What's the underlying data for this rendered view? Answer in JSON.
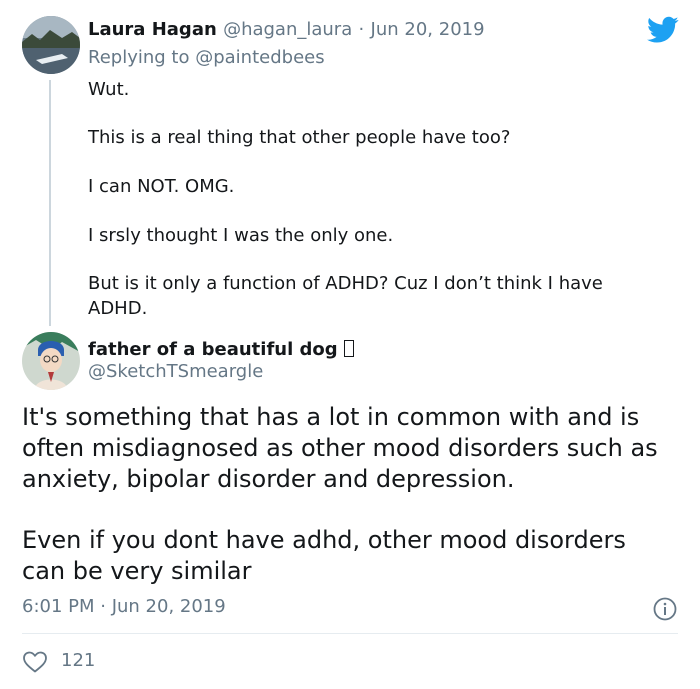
{
  "reply_tweet": {
    "display_name": "Laura Hagan",
    "handle": "@hagan_laura",
    "separator": "·",
    "date": "Jun 20, 2019",
    "replying_prefix": "Replying to",
    "replying_to": "@paintedbees",
    "paragraphs": [
      "Wut.",
      "This is a real thing that other people have too?",
      "I can NOT.  OMG.",
      "I srsly thought I was the only one.",
      "But is it only a function of ADHD? Cuz I don’t think I have",
      "ADHD."
    ],
    "avatar_icon": "lake-landscape-avatar"
  },
  "main_tweet": {
    "display_name": "father of a beautiful dog",
    "handle": "@SketchTSmeargle",
    "body_lines": [
      "It's something that has a lot in common with and is",
      "often misdiagnosed as other mood disorders such as",
      "anxiety, bipolar disorder and depression.",
      "Even if you dont have adhd, other mood disorders",
      "can be very similar"
    ],
    "timestamp": "6:01 PM · Jun 20, 2019",
    "likes": "121",
    "avatar_icon": "anime-character-avatar"
  },
  "colors": {
    "text": "#14171a",
    "secondary": "#657786",
    "twitter_blue": "#1da1f2",
    "thread_line": "#ccd6dd"
  },
  "icons": {
    "brand": "twitter-bird-icon",
    "info": "info-icon",
    "like": "heart-icon"
  }
}
